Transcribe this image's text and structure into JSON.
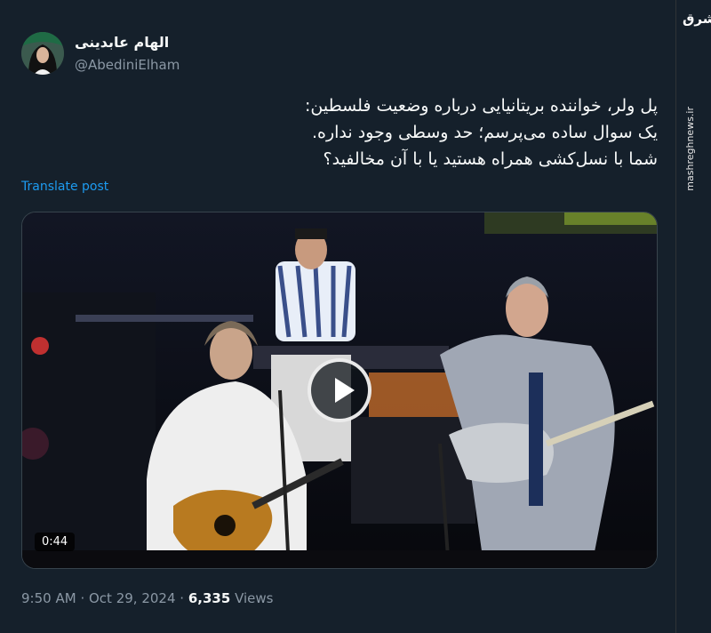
{
  "author": {
    "name": "الهام عابدینی",
    "handle": "@AbediniElham"
  },
  "tweet": {
    "lines": [
      "پل ولر، خواننده بریتانیایی درباره وضعیت فلسطین:",
      "یک سوال ساده می‌پرسم؛ حد وسطی وجود نداره.",
      "شما با نسل‌کشی همراه هستید یا با آن مخالفید؟"
    ],
    "translate_label": "Translate post"
  },
  "video": {
    "duration": "0:44",
    "play_icon": "play-icon"
  },
  "meta": {
    "time": "9:50 AM",
    "separator": "·",
    "date": "Oct 29, 2024",
    "views_count": "6,335",
    "views_label": "Views"
  },
  "watermark": {
    "logo": "مشرق",
    "site": "mashreghnews.ir"
  },
  "colors": {
    "background": "#15202b",
    "link": "#1d9bf0",
    "muted": "#8b98a5"
  }
}
